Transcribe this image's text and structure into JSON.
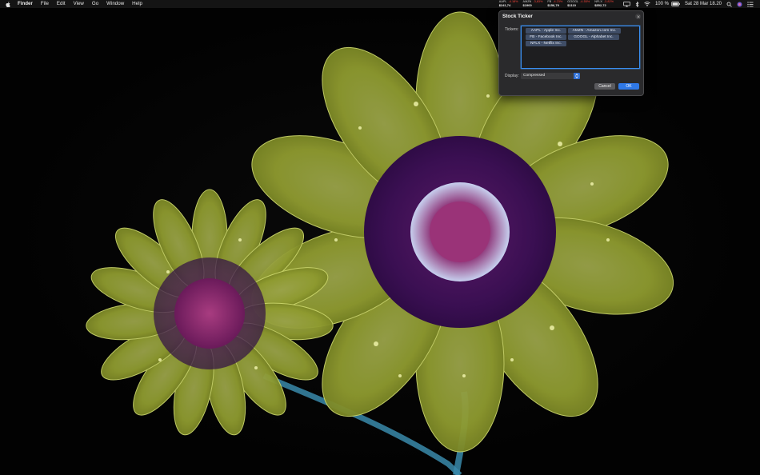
{
  "menubar": {
    "app_name": "Finder",
    "menus": [
      "File",
      "Edit",
      "View",
      "Go",
      "Window",
      "Help"
    ],
    "tickers": [
      {
        "symbol": "AAPL",
        "change": "-4.18%",
        "price": "$241,74"
      },
      {
        "symbol": "AMZN",
        "change": "-3,83%",
        "price": "$1900"
      },
      {
        "symbol": "FB",
        "change": "-4.23%",
        "price": "$156,79"
      },
      {
        "symbol": "GOOGL",
        "change": "-4.55%",
        "price": "$1110"
      },
      {
        "symbol": "NFLX",
        "change": "-3.82%",
        "price": "$352,72"
      }
    ],
    "battery": "100 %",
    "clock": "Sat 28 Mar  18.20"
  },
  "dialog": {
    "title": "Stock Ticker",
    "tickers_label": "Tickers:",
    "tokens": [
      "AAPL - Apple Inc.",
      "AMZN - Amazon.com Inc.",
      "FB - Facebook Inc.",
      "GOOGL - Alphabet Inc.",
      "NFLX - Netflix Inc."
    ],
    "display_label": "Display:",
    "display_value": "Compressed",
    "cancel_label": "Cancel",
    "ok_label": "OK"
  },
  "colors": {
    "accent": "#2f78e6",
    "negative": "#ff453a",
    "dialog_bg": "#2a2a2c",
    "token_bg": "#3f4d66"
  }
}
